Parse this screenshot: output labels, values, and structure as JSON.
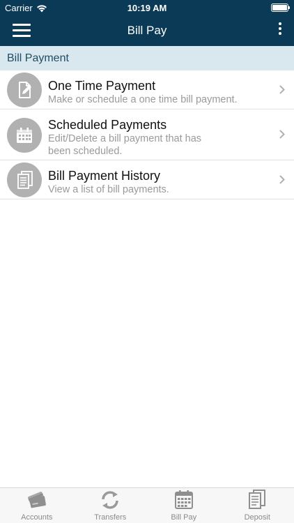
{
  "status_bar": {
    "carrier": "Carrier",
    "time": "10:19 AM",
    "battery_icon": "battery-full-icon",
    "wifi_icon": "wifi-icon"
  },
  "nav_bar": {
    "title": "Bill Pay",
    "menu_icon": "hamburger-menu-icon",
    "more_icon": "more-vertical-icon",
    "background": "#0b3a57"
  },
  "section": {
    "header": "Bill Payment"
  },
  "items": [
    {
      "title": "One Time Payment",
      "subtitle_lines": [
        "Make or schedule a one time bill payment."
      ],
      "icon": "pencil-document-icon"
    },
    {
      "title": "Scheduled Payments",
      "subtitle_lines": [
        "Edit/Delete a bill payment that has",
        "been scheduled."
      ],
      "icon": "calendar-icon"
    },
    {
      "title": "Bill Payment History",
      "subtitle_lines": [
        "View a list of bill payments."
      ],
      "icon": "document-list-icon"
    }
  ],
  "tab_bar": {
    "tabs": [
      {
        "label": "Accounts",
        "icon": "cards-icon"
      },
      {
        "label": "Transfers",
        "icon": "refresh-arrows-icon"
      },
      {
        "label": "Bill Pay",
        "icon": "calendar-icon"
      },
      {
        "label": "Deposit",
        "icon": "check-deposit-icon"
      }
    ]
  },
  "colors": {
    "header_bar": "#0b3a57",
    "section_header_bg": "#d8e8ee",
    "icon_circle": "#b1b1b1",
    "tab_text": "#8a8a8a"
  }
}
